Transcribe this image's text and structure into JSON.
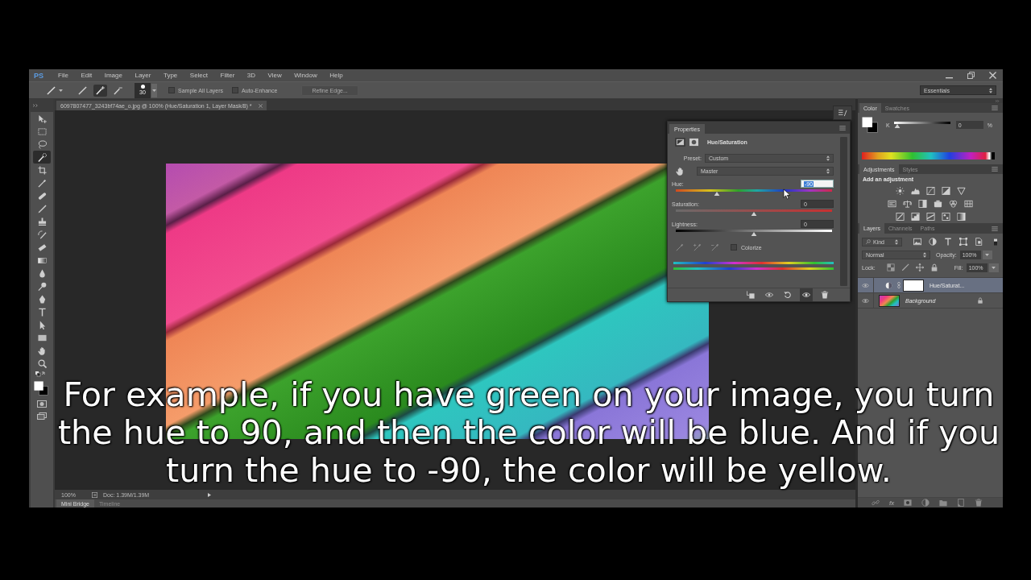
{
  "menu_bar": {
    "logo": "PS",
    "items": [
      "File",
      "Edit",
      "Image",
      "Layer",
      "Type",
      "Select",
      "Filter",
      "3D",
      "View",
      "Window",
      "Help"
    ]
  },
  "options_bar": {
    "modes": [
      {
        "selected": false
      },
      {
        "selected": true
      },
      {
        "selected": false
      }
    ],
    "brush_size": "30",
    "checkboxes": [
      {
        "label": "Sample All Layers",
        "checked": false
      },
      {
        "label": "Auto-Enhance",
        "checked": false
      }
    ],
    "refine_button": {
      "label": "Refine Edge...",
      "disabled": true
    },
    "workspace": "Essentials"
  },
  "tools": [
    {
      "kind": "move",
      "selected": false
    },
    {
      "kind": "marquee",
      "selected": false
    },
    {
      "kind": "lasso",
      "selected": false
    },
    {
      "kind": "quick_selection",
      "selected": true
    },
    {
      "kind": "crop",
      "selected": false
    },
    {
      "kind": "eyedropper",
      "selected": false
    },
    {
      "kind": "healing",
      "selected": false
    },
    {
      "kind": "brush",
      "selected": false
    },
    {
      "kind": "stamp",
      "selected": false
    },
    {
      "kind": "history_brush",
      "selected": false
    },
    {
      "kind": "eraser",
      "selected": false
    },
    {
      "kind": "gradient",
      "selected": false
    },
    {
      "kind": "blur",
      "selected": false
    },
    {
      "kind": "dodge",
      "selected": false
    },
    {
      "kind": "pen",
      "selected": false
    },
    {
      "kind": "type",
      "selected": false
    },
    {
      "kind": "path_selection",
      "selected": false
    },
    {
      "kind": "shape",
      "selected": false
    },
    {
      "kind": "hand",
      "selected": false
    },
    {
      "kind": "zoom",
      "selected": false
    }
  ],
  "document_tab": {
    "title": "6097807477_3243bf74ae_o.jpg @ 100% (Hue/Saturation 1, Layer Mask/8) *"
  },
  "properties_panel": {
    "tab": "Properties",
    "title": "Hue/Saturation",
    "preset_label": "Preset:",
    "preset": "Custom",
    "channel": "Master",
    "sliders": [
      {
        "kind": "hue",
        "label": "Hue:",
        "value": "-90",
        "focused": true,
        "level": 0.25
      },
      {
        "kind": "saturation",
        "label": "Saturation:",
        "value": "0",
        "focused": false,
        "level": 0.5
      },
      {
        "kind": "lightness",
        "label": "Lightness:",
        "value": "0",
        "focused": false,
        "level": 0.5
      }
    ],
    "colorize": {
      "label": "Colorize",
      "checked": false
    }
  },
  "color_panel": {
    "tabs": [
      {
        "label": "Color",
        "selected": true
      },
      {
        "label": "Swatches",
        "selected": false
      }
    ],
    "channel": "K",
    "value": "0",
    "unit": "%",
    "level": 0
  },
  "adjustments_panel": {
    "tabs": [
      {
        "label": "Adjustments",
        "selected": true
      },
      {
        "label": "Styles",
        "selected": false
      }
    ],
    "heading": "Add an adjustment"
  },
  "layers_panel": {
    "tabs": [
      {
        "label": "Layers",
        "selected": true
      },
      {
        "label": "Channels",
        "selected": false
      },
      {
        "label": "Paths",
        "selected": false
      }
    ],
    "filter": "Kind",
    "filter_on": true,
    "blend_mode": "Normal",
    "opacity_label": "Opacity:",
    "opacity": "100%",
    "lock_label": "Lock:",
    "fill_label": "Fill:",
    "fill": "100%",
    "layers": [
      {
        "kind": "adjustment",
        "name": "Hue/Saturat...",
        "selected": true,
        "visible": true,
        "locked": false
      },
      {
        "kind": "image",
        "name": "Background",
        "selected": false,
        "visible": true,
        "locked": true
      }
    ],
    "fx_button": "fx"
  },
  "status_bar": {
    "zoom": "100%",
    "doc": "Doc: 1.39M/1.39M"
  },
  "bottom_tabs": [
    {
      "label": "Mini Bridge",
      "selected": true
    },
    {
      "label": "Timeline",
      "selected": false
    }
  ],
  "caption": "For example, if you have green on your image, you turn the hue to 90, and then the color will be blue. And if you turn the hue to -90, the color will be yellow."
}
